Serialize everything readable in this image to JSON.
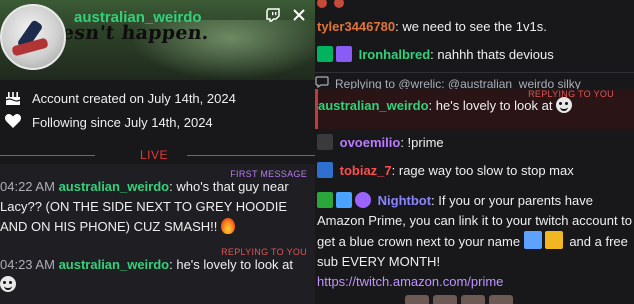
{
  "card": {
    "username": "australian_weirdo",
    "banner_text": "esn't happen.",
    "account_created": "Account created on July 14th, 2024",
    "following_since": "Following since July 14th, 2024",
    "live_label": "LIVE",
    "messages": [
      {
        "tag": "FIRST MESSAGE",
        "time": "04:22 AM",
        "user": "australian_weirdo",
        "text": "who's that guy near Lacy?? (ON THE SIDE NEXT TO GREY HOODIE AND ON HIS PHONE) CUZ SMASH!!"
      },
      {
        "tag": "REPLYING TO YOU",
        "time": "04:23 AM",
        "user": "australian_weirdo",
        "text": "he's lovely to look at"
      }
    ]
  },
  "chat": {
    "messages": [
      {
        "user": "tyler3446780",
        "text": "we need to see the 1v1s."
      },
      {
        "user": "Ironhalbred",
        "text": "nahhh thats devious"
      },
      {
        "reply_context": "Replying to @wrelic: @australian_weirdo silky"
      },
      {
        "tag": "REPLYING TO YOU",
        "user": "australian_weirdo",
        "text": "he's lovely to look at"
      },
      {
        "user": "ovoemilio",
        "text": "!prime"
      },
      {
        "user": "tobiaz_7",
        "text": "rage way too slow to stop max"
      },
      {
        "user": "Nightbot",
        "text": "If you or your parents have Amazon Prime, you can link it to your twitch account to get a blue crown next to your name",
        "text2": "and a free sub EVERY MONTH!",
        "link": "https://twitch.amazon.com/prime"
      }
    ]
  },
  "colors": {
    "live_red": "#e53838",
    "name_green": "#33d17a",
    "first_msg_purple": "#b77af0",
    "reply_red": "#e05555"
  },
  "icons": [
    "twitch-icon",
    "close-icon",
    "cake-icon",
    "heart-icon",
    "reply-icon",
    "fire-emoji",
    "face-emoji"
  ]
}
